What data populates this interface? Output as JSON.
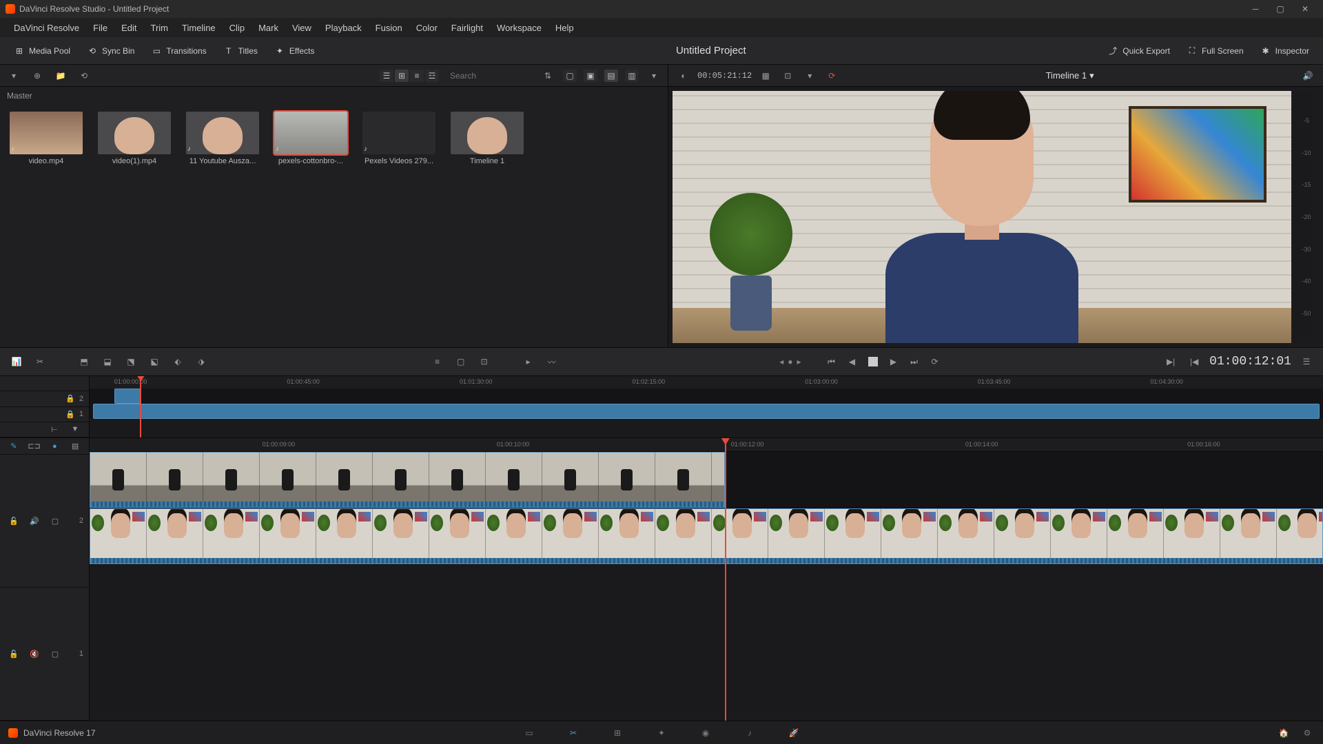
{
  "titlebar": {
    "title": "DaVinci Resolve Studio - Untitled Project"
  },
  "menu": [
    "DaVinci Resolve",
    "File",
    "Edit",
    "Trim",
    "Timeline",
    "Clip",
    "Mark",
    "View",
    "Playback",
    "Fusion",
    "Color",
    "Fairlight",
    "Workspace",
    "Help"
  ],
  "toolbar": {
    "left": [
      {
        "name": "media-pool",
        "label": "Media Pool"
      },
      {
        "name": "sync-bin",
        "label": "Sync Bin"
      },
      {
        "name": "transitions",
        "label": "Transitions"
      },
      {
        "name": "titles",
        "label": "Titles"
      },
      {
        "name": "effects",
        "label": "Effects"
      }
    ],
    "project_title": "Untitled Project",
    "right": [
      {
        "name": "quick-export",
        "label": "Quick Export"
      },
      {
        "name": "full-screen",
        "label": "Full Screen"
      },
      {
        "name": "inspector",
        "label": "Inspector"
      }
    ]
  },
  "media": {
    "breadcrumb": "Master",
    "search_placeholder": "Search",
    "clips": [
      {
        "name": "video.mp4",
        "thumb": "thb-sky",
        "audio": true
      },
      {
        "name": "video(1).mp4",
        "thumb": "thb-face",
        "audio": false
      },
      {
        "name": "11 Youtube Ausza...",
        "thumb": "thb-face",
        "audio": true
      },
      {
        "name": "pexels-cottonbro-...",
        "thumb": "thb-gray",
        "audio": true,
        "selected": true
      },
      {
        "name": "Pexels Videos 279...",
        "thumb": "thb-dark",
        "audio": true
      },
      {
        "name": "Timeline 1",
        "thumb": "thb-face",
        "audio": false
      }
    ]
  },
  "viewer": {
    "timeline_name": "Timeline 1",
    "counter": "00:05:21:12",
    "timecode": "01:00:12:01",
    "meters_db": [
      "-5",
      "-10",
      "-15",
      "-20",
      "-30",
      "-40",
      "-50"
    ]
  },
  "timeline_mini": {
    "ruler": [
      {
        "pos": 2,
        "label": "01:00:00:00"
      },
      {
        "pos": 16,
        "label": "01:00:45:00"
      },
      {
        "pos": 30,
        "label": "01:01:30:00"
      },
      {
        "pos": 44,
        "label": "01:02:15:00"
      },
      {
        "pos": 58,
        "label": "01:03:00:00"
      },
      {
        "pos": 72,
        "label": "01:03:45:00"
      },
      {
        "pos": 86,
        "label": "01:04:30:00"
      }
    ],
    "tracks": [
      "2",
      "1"
    ],
    "playhead_pct": 4.1
  },
  "timeline_main": {
    "ruler": [
      {
        "pos": 14,
        "label": "01:00:09:00"
      },
      {
        "pos": 33,
        "label": "01:00:10:00"
      },
      {
        "pos": 52,
        "label": "01:00:12:00"
      },
      {
        "pos": 71,
        "label": "01:00:14:00"
      },
      {
        "pos": 89,
        "label": "01:00:16:00"
      }
    ],
    "tracks": [
      "2",
      "1"
    ],
    "playhead_pct": 51.5
  },
  "pagebar": {
    "version": "DaVinci Resolve 17"
  }
}
